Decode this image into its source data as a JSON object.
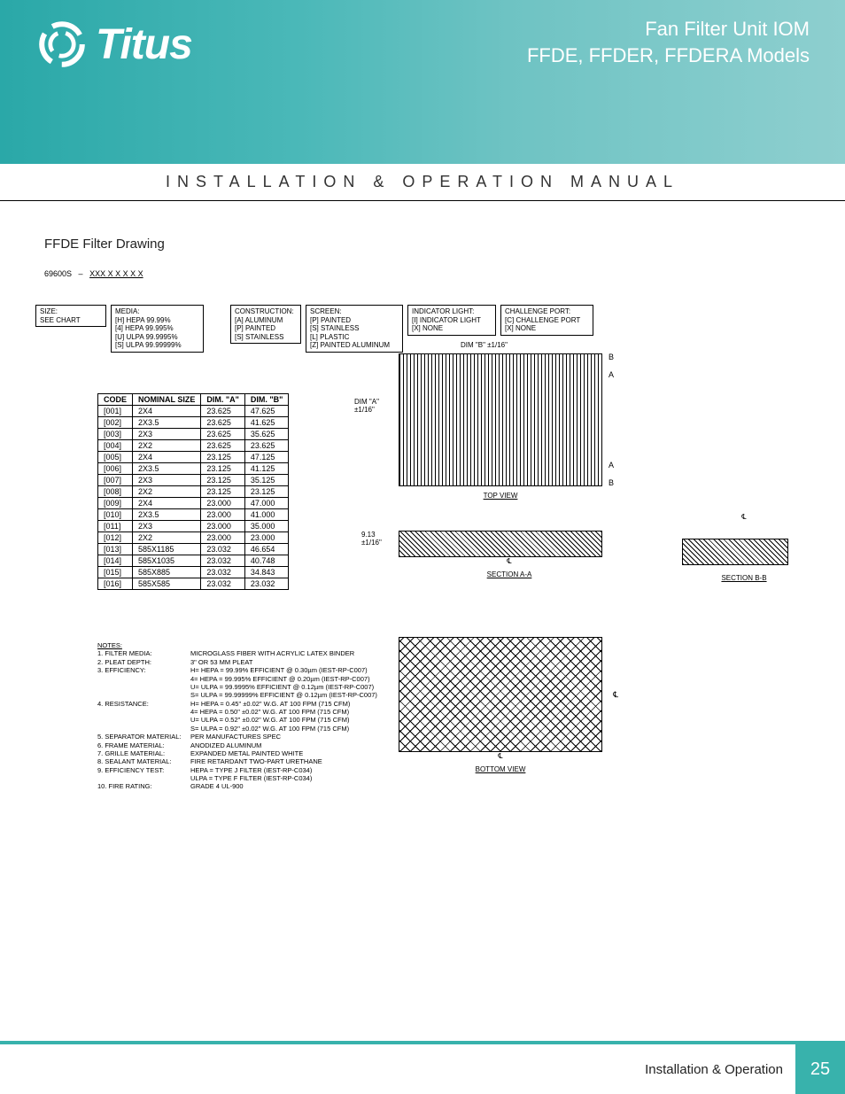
{
  "header": {
    "brand": "Titus",
    "title1": "Fan Filter Unit IOM",
    "title2": "FFDE, FFDER, FFDERA Models"
  },
  "subheading": "INSTALLATION & OPERATION MANUAL",
  "section_title": "FFDE Filter Drawing",
  "part_number": {
    "root": "69600S",
    "sep": "–",
    "placeholders": "XXX   X   X   X   X   X"
  },
  "options": {
    "size": {
      "title": "SIZE:",
      "lines": [
        "SEE CHART"
      ]
    },
    "media": {
      "title": "MEDIA:",
      "lines": [
        "[H] HEPA 99.99%",
        "[4] HEPA 99.995%",
        "[U] ULPA 99.9995%",
        "[S] ULPA 99.99999%"
      ]
    },
    "construction": {
      "title": "CONSTRUCTION:",
      "lines": [
        "[A] ALUMINUM",
        "[P] PAINTED",
        "[S] STAINLESS"
      ]
    },
    "screen": {
      "title": "SCREEN:",
      "lines": [
        "[P] PAINTED",
        "[S] STAINLESS",
        "[L] PLASTIC",
        "[Z] PAINTED ALUMINUM"
      ]
    },
    "indicator": {
      "title": "INDICATOR LIGHT:",
      "lines": [
        "[I] INDICATOR LIGHT",
        "[X] NONE"
      ]
    },
    "challenge": {
      "title": "CHALLENGE PORT:",
      "lines": [
        "[C] CHALLENGE PORT",
        "[X] NONE"
      ]
    }
  },
  "size_table": {
    "headers": [
      "CODE",
      "NOMINAL SIZE",
      "DIM. \"A\"",
      "DIM. \"B\""
    ],
    "rows": [
      [
        "[001]",
        "2X4",
        "23.625",
        "47.625"
      ],
      [
        "[002]",
        "2X3.5",
        "23.625",
        "41.625"
      ],
      [
        "[003]",
        "2X3",
        "23.625",
        "35.625"
      ],
      [
        "[004]",
        "2X2",
        "23.625",
        "23.625"
      ],
      [
        "[005]",
        "2X4",
        "23.125",
        "47.125"
      ],
      [
        "[006]",
        "2X3.5",
        "23.125",
        "41.125"
      ],
      [
        "[007]",
        "2X3",
        "23.125",
        "35.125"
      ],
      [
        "[008]",
        "2X2",
        "23.125",
        "23.125"
      ],
      [
        "[009]",
        "2X4",
        "23.000",
        "47.000"
      ],
      [
        "[010]",
        "2X3.5",
        "23.000",
        "41.000"
      ],
      [
        "[011]",
        "2X3",
        "23.000",
        "35.000"
      ],
      [
        "[012]",
        "2X2",
        "23.000",
        "23.000"
      ],
      [
        "[013]",
        "585X1185",
        "23.032",
        "46.654"
      ],
      [
        "[014]",
        "585X1035",
        "23.032",
        "40.748"
      ],
      [
        "[015]",
        "585X885",
        "23.032",
        "34.843"
      ],
      [
        "[016]",
        "585X585",
        "23.032",
        "23.032"
      ]
    ]
  },
  "notes_heading": "NOTES:",
  "notes": [
    {
      "n": "1.",
      "label": "FILTER MEDIA:",
      "lines": [
        "MICROGLASS FIBER WITH ACRYLIC LATEX BINDER"
      ]
    },
    {
      "n": "2.",
      "label": "PLEAT DEPTH:",
      "lines": [
        "3\" OR 53 MM PLEAT"
      ]
    },
    {
      "n": "3.",
      "label": "EFFICIENCY:",
      "lines": [
        "H= HEPA = 99.99% EFFICIENT @ 0.30µm (IEST-RP-C007)",
        "4= HEPA = 99.995% EFFICIENT @ 0.20µm (IEST-RP-C007)",
        "U= ULPA = 99.9995% EFFICIENT @ 0.12µm (IEST-RP-C007)",
        "S= ULPA = 99.99999% EFFICIENT @ 0.12µm (IEST-RP-C007)"
      ]
    },
    {
      "n": "4.",
      "label": "RESISTANCE:",
      "lines": [
        "H= HEPA = 0.45\" ±0.02\" W.G. AT 100 FPM (715 CFM)",
        "4= HEPA = 0.50\" ±0.02\" W.G. AT 100 FPM (715 CFM)",
        "U= ULPA = 0.52\" ±0.02\" W.G. AT 100 FPM (715 CFM)",
        "S= ULPA = 0.92\" ±0.02\" W.G. AT 100 FPM (715 CFM)"
      ]
    },
    {
      "n": "5.",
      "label": "SEPARATOR MATERIAL:",
      "lines": [
        "PER MANUFACTURES SPEC"
      ]
    },
    {
      "n": "6.",
      "label": "FRAME MATERIAL:",
      "lines": [
        "ANODIZED ALUMINUM"
      ]
    },
    {
      "n": "7.",
      "label": "GRILLE MATERIAL:",
      "lines": [
        "EXPANDED METAL PAINTED WHITE"
      ]
    },
    {
      "n": "8.",
      "label": "SEALANT MATERIAL:",
      "lines": [
        "FIRE RETARDANT TWO-PART URETHANE"
      ]
    },
    {
      "n": "9.",
      "label": "EFFICIENCY TEST:",
      "lines": [
        "HEPA = TYPE J FILTER (IEST-RP-C034)",
        "ULPA = TYPE F FILTER (IEST-RP-C034)"
      ]
    },
    {
      "n": "10.",
      "label": "FIRE RATING:",
      "lines": [
        "GRADE 4 UL-900"
      ]
    }
  ],
  "dims": {
    "dim_b": "DIM \"B\" ±1/16\"",
    "dim_a": "DIM \"A\"\n±1/16\"",
    "sec_h": "9.13\n±1/16\"",
    "top_view": "TOP VIEW",
    "section_aa": "SECTION A-A",
    "section_bb": "SECTION B-B",
    "bottom_view": "BOTTOM VIEW",
    "cl": "℄",
    "a_mark": "A",
    "b_mark": "B"
  },
  "footer": {
    "label": "Installation & Operation",
    "page": "25"
  }
}
